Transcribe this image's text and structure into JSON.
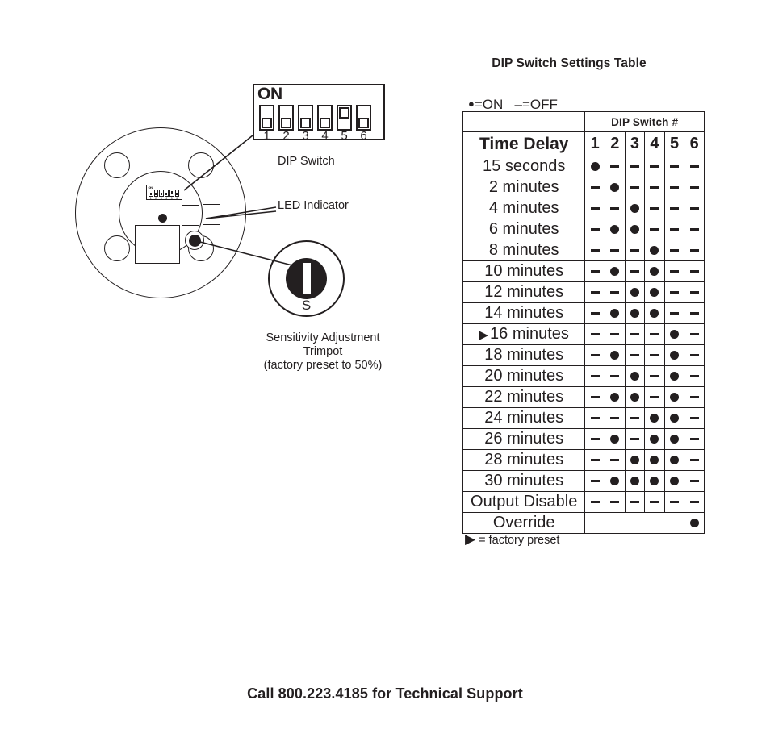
{
  "diagram": {
    "dip_switch_callout": {
      "on_label": "ON",
      "numbers": [
        "1",
        "2",
        "3",
        "4",
        "5",
        "6"
      ],
      "positions": [
        "off",
        "off",
        "off",
        "off",
        "on",
        "off"
      ],
      "caption": "DIP Switch"
    },
    "mini_dip": {
      "on_label": "ON",
      "numbers": [
        "1",
        "2",
        "3",
        "4",
        "5",
        "6"
      ],
      "positions": [
        "off",
        "off",
        "off",
        "off",
        "on",
        "off"
      ]
    },
    "led_indicator_caption": "LED Indicator",
    "trimpot": {
      "dial_label": "S",
      "caption_line1": "Sensitivity Adjustment",
      "caption_line2": "Trimpot",
      "caption_line3": "(factory preset to 50%)"
    }
  },
  "table": {
    "title": "DIP Switch Settings Table",
    "legend_on": "=ON",
    "legend_off": "=OFF",
    "switch_group_header": "DIP Switch #",
    "row_header_label": "Time Delay",
    "switch_numbers": [
      "1",
      "2",
      "3",
      "4",
      "5",
      "6"
    ],
    "preset_marker": "▶",
    "preset_legend": "= factory preset",
    "header_fill": "#c8c8c8",
    "rows": [
      {
        "label": "15 seconds",
        "preset": false,
        "switches": [
          "on",
          "off",
          "off",
          "off",
          "off",
          "off"
        ]
      },
      {
        "label": "2 minutes",
        "preset": false,
        "switches": [
          "off",
          "on",
          "off",
          "off",
          "off",
          "off"
        ]
      },
      {
        "label": "4 minutes",
        "preset": false,
        "switches": [
          "off",
          "off",
          "on",
          "off",
          "off",
          "off"
        ]
      },
      {
        "label": "6 minutes",
        "preset": false,
        "switches": [
          "off",
          "on",
          "on",
          "off",
          "off",
          "off"
        ]
      },
      {
        "label": "8 minutes",
        "preset": false,
        "switches": [
          "off",
          "off",
          "off",
          "on",
          "off",
          "off"
        ]
      },
      {
        "label": "10 minutes",
        "preset": false,
        "switches": [
          "off",
          "on",
          "off",
          "on",
          "off",
          "off"
        ]
      },
      {
        "label": "12 minutes",
        "preset": false,
        "switches": [
          "off",
          "off",
          "on",
          "on",
          "off",
          "off"
        ]
      },
      {
        "label": "14 minutes",
        "preset": false,
        "switches": [
          "off",
          "on",
          "on",
          "on",
          "off",
          "off"
        ]
      },
      {
        "label": "16 minutes",
        "preset": true,
        "switches": [
          "off",
          "off",
          "off",
          "off",
          "on",
          "off"
        ]
      },
      {
        "label": "18 minutes",
        "preset": false,
        "switches": [
          "off",
          "on",
          "off",
          "off",
          "on",
          "off"
        ]
      },
      {
        "label": "20 minutes",
        "preset": false,
        "switches": [
          "off",
          "off",
          "on",
          "off",
          "on",
          "off"
        ]
      },
      {
        "label": "22 minutes",
        "preset": false,
        "switches": [
          "off",
          "on",
          "on",
          "off",
          "on",
          "off"
        ]
      },
      {
        "label": "24 minutes",
        "preset": false,
        "switches": [
          "off",
          "off",
          "off",
          "on",
          "on",
          "off"
        ]
      },
      {
        "label": "26 minutes",
        "preset": false,
        "switches": [
          "off",
          "on",
          "off",
          "on",
          "on",
          "off"
        ]
      },
      {
        "label": "28 minutes",
        "preset": false,
        "switches": [
          "off",
          "off",
          "on",
          "on",
          "on",
          "off"
        ]
      },
      {
        "label": "30 minutes",
        "preset": false,
        "switches": [
          "off",
          "on",
          "on",
          "on",
          "on",
          "off"
        ]
      },
      {
        "label": "Output Disable",
        "preset": false,
        "switches": [
          "off",
          "off",
          "off",
          "off",
          "off",
          "off"
        ]
      },
      {
        "label": "Override",
        "preset": false,
        "switches": [
          "na",
          "na",
          "na",
          "na",
          "na",
          "on"
        ]
      }
    ]
  },
  "footer": {
    "support_text": "Call 800.223.4185 for Technical Support"
  }
}
